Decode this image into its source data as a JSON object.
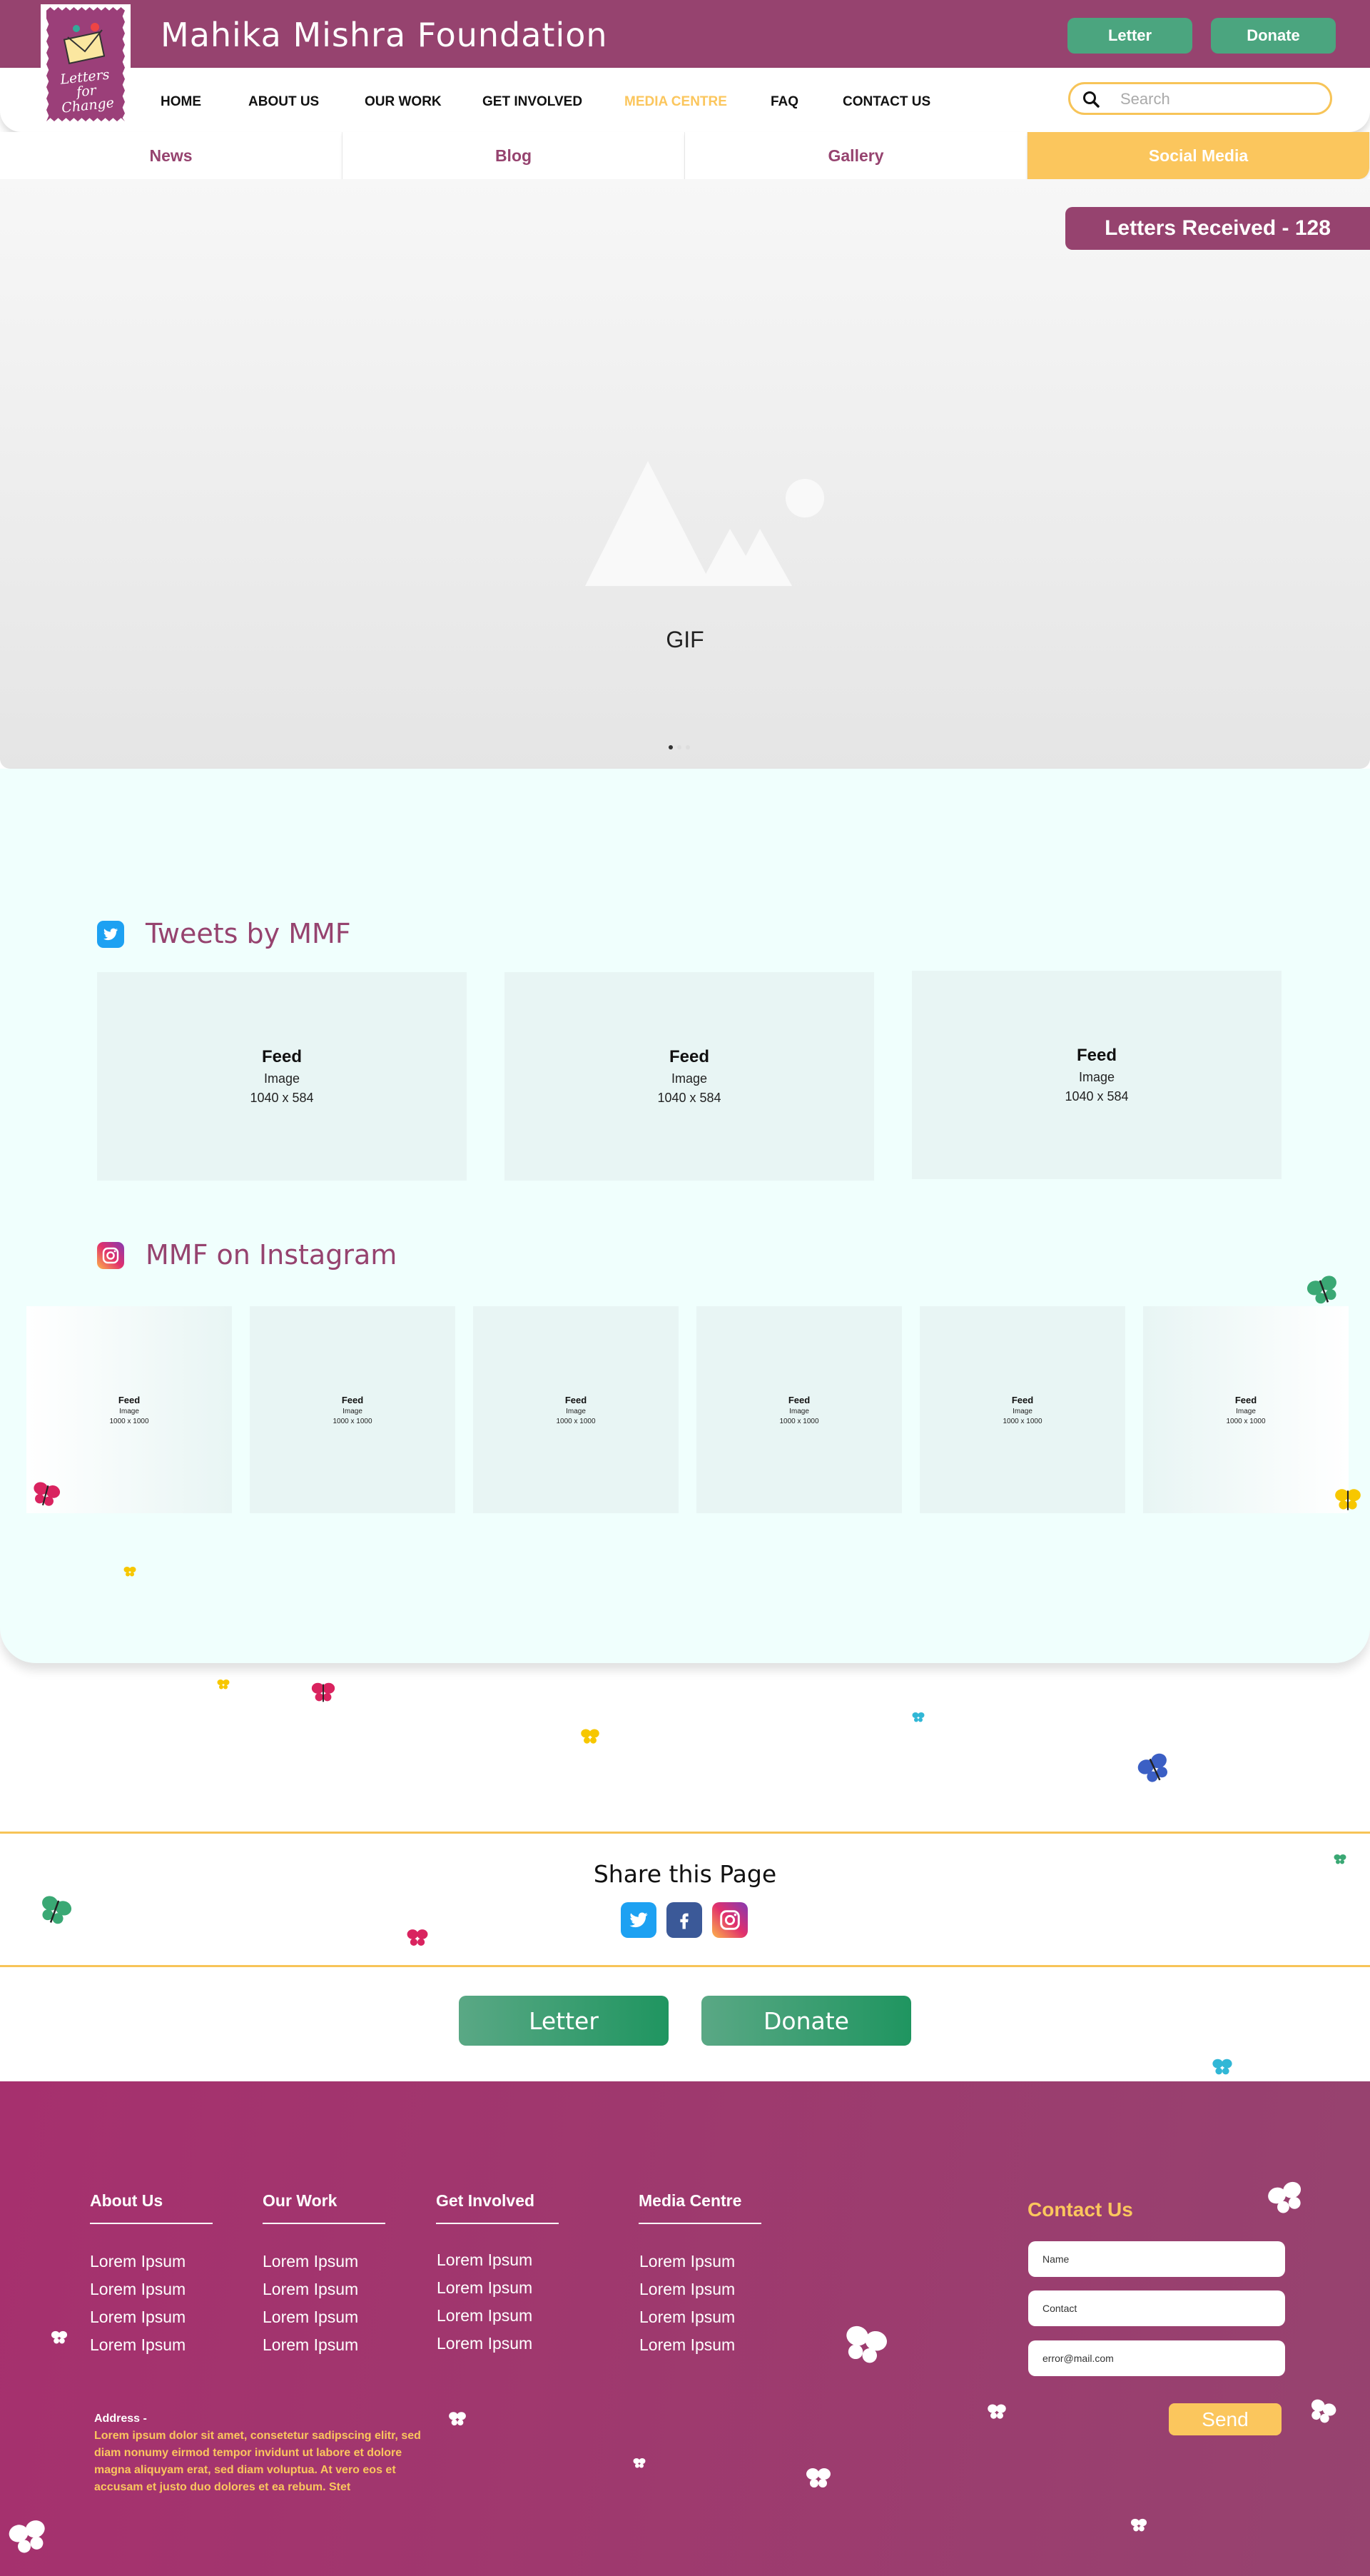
{
  "header": {
    "site_title": "Mahika Mishra Foundation",
    "logo_text": "Letters for Change",
    "letter_button": "Letter",
    "donate_button": "Donate",
    "search_placeholder": "Search"
  },
  "nav": {
    "items": [
      "HOME",
      "ABOUT US",
      "OUR WORK",
      "GET INVOLVED",
      "MEDIA CENTRE",
      "FAQ",
      "CONTACT US"
    ],
    "active": "MEDIA CENTRE"
  },
  "subnav": {
    "tabs": [
      "News",
      "Blog",
      "Gallery",
      "Social Media"
    ],
    "active": "Social Media"
  },
  "hero": {
    "letters_received": "Letters Received - 128",
    "gif_label": "GIF"
  },
  "tweets": {
    "title": "Tweets by MMF",
    "cards": [
      {
        "title": "Feed",
        "sub": "Image",
        "size": "1040 x 584"
      },
      {
        "title": "Feed",
        "sub": "Image",
        "size": "1040 x 584"
      },
      {
        "title": "Feed",
        "sub": "Image",
        "size": "1040 x 584"
      }
    ]
  },
  "instagram": {
    "title": "MMF on Instagram",
    "cards": [
      {
        "title": "Feed",
        "sub": "Image",
        "size": "1000 x 1000"
      },
      {
        "title": "Feed",
        "sub": "Image",
        "size": "1000 x 1000"
      },
      {
        "title": "Feed",
        "sub": "Image",
        "size": "1000 x 1000"
      },
      {
        "title": "Feed",
        "sub": "Image",
        "size": "1000 x 1000"
      },
      {
        "title": "Feed",
        "sub": "Image",
        "size": "1000 x 1000"
      },
      {
        "title": "Feed",
        "sub": "Image",
        "size": "1000 x 1000"
      }
    ]
  },
  "share": {
    "title": "Share this Page"
  },
  "cta": {
    "letter": "Letter",
    "donate": "Donate"
  },
  "footer": {
    "columns": [
      {
        "title": "About Us",
        "links": [
          "Lorem Ipsum",
          "Lorem Ipsum",
          "Lorem Ipsum",
          "Lorem Ipsum"
        ]
      },
      {
        "title": "Our Work",
        "links": [
          "Lorem Ipsum",
          "Lorem Ipsum",
          "Lorem Ipsum",
          "Lorem Ipsum"
        ]
      },
      {
        "title": "Get Involved",
        "links": [
          "Lorem Ipsum",
          "Lorem Ipsum",
          "Lorem Ipsum",
          "Lorem Ipsum"
        ]
      },
      {
        "title": "Media Centre",
        "links": [
          "Lorem Ipsum",
          "Lorem Ipsum",
          "Lorem Ipsum",
          "Lorem Ipsum"
        ]
      }
    ],
    "contact": {
      "title": "Contact Us",
      "name_placeholder": "Name",
      "contact_placeholder": "Contact",
      "email_placeholder": "error@mail.com",
      "send": "Send"
    },
    "address_label": "Address -",
    "address_text": "Lorem ipsum dolor sit amet, consetetur sadipscing elitr, sed diam nonumy eirmod tempor invidunt ut labore et dolore magna aliquyam erat, sed diam voluptua. At vero eos et accusam et justo duo dolores et ea rebum. Stet"
  },
  "colors": {
    "brand_purple": "#96436f",
    "accent_gold": "#fbc65d",
    "button_green": "#4ba57f",
    "section_bg": "#f0fffd"
  }
}
